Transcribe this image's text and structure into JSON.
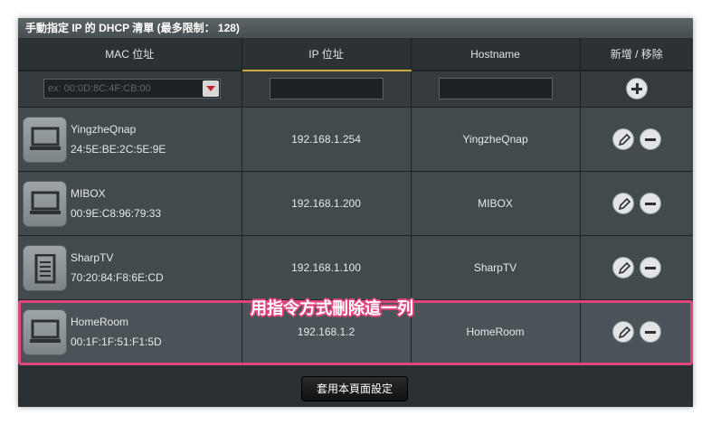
{
  "panel": {
    "title": "手動指定 IP 的 DHCP 清單 (最多限制： 128)"
  },
  "table": {
    "headers": {
      "mac": "MAC 位址",
      "ip": "IP 位址",
      "hostname": "Hostname",
      "action": "新增 / 移除"
    },
    "input_row": {
      "mac_placeholder": "ex: 00:0D:8C:4F:CB:00",
      "ip_value": "",
      "hostname_value": ""
    },
    "rows": [
      {
        "name": "YingzheQnap",
        "mac": "24:5E:BE:2C:5E:9E",
        "ip": "192.168.1.254",
        "hostname": "YingzheQnap",
        "device": "laptop-icon"
      },
      {
        "name": "MIBOX",
        "mac": "00:9E:C8:96:79:33",
        "ip": "192.168.1.200",
        "hostname": "MIBOX",
        "device": "laptop-icon"
      },
      {
        "name": "SharpTV",
        "mac": "70:20:84:F8:6E:CD",
        "ip": "192.168.1.100",
        "hostname": "SharpTV",
        "device": "document-device-icon"
      },
      {
        "name": "HomeRoom",
        "mac": "00:1F:1F:51:F1:5D",
        "ip": "192.168.1.2",
        "hostname": "HomeRoom",
        "device": "laptop-icon"
      }
    ]
  },
  "annotation": {
    "text": "用指令方式刪除這一列",
    "color": "#e0467d"
  },
  "footer": {
    "apply_label": "套用本頁面設定"
  },
  "colors": {
    "panel_bg": "#2a3033",
    "row_bg": "#414a4d",
    "header_accent": "#c8a93c"
  }
}
